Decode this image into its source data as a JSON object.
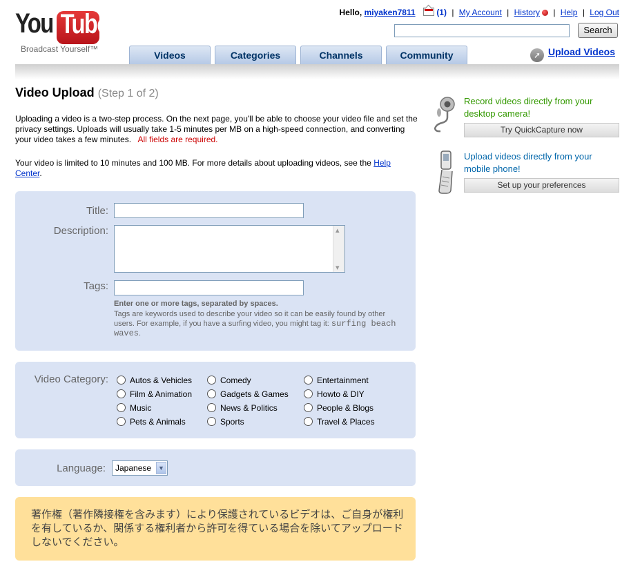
{
  "brand": {
    "logo_you": "You",
    "logo_tube": "Tube",
    "tagline": "Broadcast Yourself™"
  },
  "account": {
    "hello": "Hello,",
    "username": "miyaken7811",
    "message_count": "(1)",
    "my_account": "My Account",
    "history": "History",
    "help": "Help",
    "logout": "Log Out"
  },
  "search": {
    "button": "Search",
    "value": ""
  },
  "nav": {
    "tabs": [
      "Videos",
      "Categories",
      "Channels",
      "Community"
    ],
    "upload": "Upload Videos"
  },
  "page": {
    "title": "Video Upload",
    "step": "(Step 1 of 2)",
    "intro": "Uploading a video is a two-step process. On the next page, you'll be able to choose your video file and set the privacy settings. Uploads will usually take 1-5 minutes per MB on a high-speed connection, and converting your video takes a few minutes.",
    "required": "All fields are required.",
    "limit_text": "Your video is limited to 10 minutes and 100 MB. For more details about uploading videos, see the",
    "help_center": "Help Center",
    "period": "."
  },
  "form": {
    "title_label": "Title:",
    "title_value": "",
    "description_label": "Description:",
    "description_value": "",
    "tags_label": "Tags:",
    "tags_value": "",
    "tags_help_bold": "Enter one or more tags, separated by spaces.",
    "tags_help": "Tags are keywords used to describe your video so it can be easily found by other users. For example, if you have a surfing video, you might tag it:",
    "tags_example": "surfing beach waves",
    "tags_example_end": "."
  },
  "category": {
    "label": "Video Category:",
    "options": [
      "Autos & Vehicles",
      "Comedy",
      "Entertainment",
      "Film & Animation",
      "Gadgets & Games",
      "Howto & DIY",
      "Music",
      "News & Politics",
      "People & Blogs",
      "Pets & Animals",
      "Sports",
      "Travel & Places"
    ]
  },
  "language": {
    "label": "Language:",
    "selected": "Japanese"
  },
  "notice": {
    "text": "著作権（著作隣接権を含みます）により保護されているビデオは、ご自身が権利を有しているか、関係する権利者から許可を得ている場合を除いてアップロードしないでください。"
  },
  "sidebar": {
    "quickcapture_line1": "Record videos directly from your",
    "quickcapture_line2": "desktop camera!",
    "quickcapture_button": "Try QuickCapture now",
    "mobile_line1": "Upload videos directly from your",
    "mobile_line2": "mobile phone!",
    "mobile_button": "Set up your preferences",
    "colors": {
      "quickcapture_text": "#339900",
      "mobile_text": "#0066aa"
    }
  }
}
